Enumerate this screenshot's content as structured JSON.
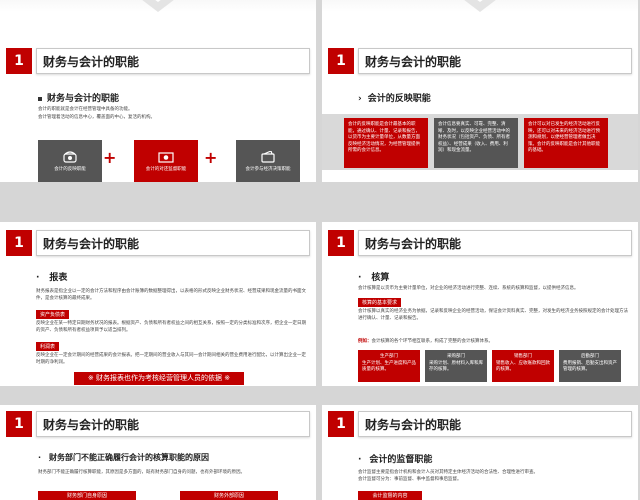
{
  "slide1": {
    "num": "1",
    "title": "财务与会计的职能",
    "subtitle": "财务与会计的职能",
    "body": [
      "会计的职能就是会计在经营管理中具备的功能。",
      "会计管理着活动的信息中心，覆盖面的中心，复活的机构。"
    ],
    "icons": [
      {
        "label": "会计的反映职能",
        "icon": "phone-icon"
      },
      {
        "label": "会计的对还监督职能",
        "icon": "money-icon"
      },
      {
        "label": "会计参与经济决策职能",
        "icon": "wallet-icon"
      }
    ],
    "plus": "+"
  },
  "slide2": {
    "num": "1",
    "title": "财务与会计的职能",
    "subtitle": "会计的反映职能",
    "boxes": [
      "会计的反映职能是会计最基本的职能，通过确认、计量、记录和报告，以货币为主要计量单位，从数量方面反映经济活动情况，为经营管理提供所需的会计信息。",
      "会计信息要真实、可靠、完整、清晰、及时，以反映企业经营活动中的财务状况（包括资产、负债、所有者权益）、经营成果（收入、费用、利润）和现金流量。",
      "会计可以对已发生的经济活动进行反映，还可以对未来的经济活动进行预测和规划，以便经营管理者做出决策。会计的反映职能是会计其他职能的基础。"
    ]
  },
  "slide3": {
    "num": "1",
    "title": "财务与会计的职能",
    "subtitle": "报表",
    "intro": "财务报表是指企业以一定的会计方法和程序由会计账簿的数据整理得出，以表格的形式反映企业财务状况、经营成果和现金流量的书面文件，是会计核算的最终成果。",
    "tag1": "资产负债表",
    "tag1_text": "反映企业在某一特定日期财务状况的报表。根据资产、负债和所有者权益之间的相互关系，按照一定的分类标准和次序，把企业一定日期的资产、负债和所有者权益项目予以适当排列。",
    "tag2": "利润表",
    "tag2_text": "反映企业在一定会计期间的经营成果的会计报表。把一定期间的营业收入与其同一会计期间相关的营业费用进行配比，以计算出企业一定时期的净利润。",
    "banner": "※ 财务报表也作为考核经营管理人员的依据 ※"
  },
  "slide4": {
    "num": "1",
    "title": "财务与会计的职能",
    "subtitle": "核算",
    "intro": "会计核算是以货币为主要计量单位，对企业的经济活动进行完整、连续、系统的核算和监督，以提供经济信息。",
    "tag": "核算的基本要求",
    "tag_text": "会计核算以真实的经济业务为依据，记录和反映企业的经营活动，保证会计资料真实、完整，对发生的经济业务按照规定的会计处理方法进行确认、计量、记录和报告。",
    "note_label": "例如：",
    "note": "会计核算的各个环节相互联系，构成了完整的会计核算体系。",
    "boxes": [
      {
        "head": "生产部门",
        "text": "生产计划、生产进度和产品质量的核算。"
      },
      {
        "head": "采购部门",
        "text": "采购计划、原材料入库和库存的核算。"
      },
      {
        "head": "销售部门",
        "text": "销售收入、应收账款和回款的核算。"
      },
      {
        "head": "后勤部门",
        "text": "费用报销、后勤支出和资产管理的核算。"
      }
    ]
  },
  "slide5": {
    "num": "1",
    "title": "财务与会计的职能",
    "subtitle": "财务部门不能正确履行会计的核算职能的原因",
    "intro": "财务部门不能正确履行核算职能，其原因是多方面的，既有财务部门自身的问题，也有外部环境的原因。",
    "btn1": "财务部门自身原因",
    "btn2": "财务外部原因"
  },
  "slide6": {
    "num": "1",
    "title": "财务与会计的职能",
    "subtitle": "会计的监督职能",
    "intro": "会计监督主要是指会计机构和会计人员对其特定主体经济活动的合法性、合理性进行审查。",
    "intro2": "会计监督可分为：事前监督、事中监督和事后监督。",
    "btn": "会计监督的内容"
  }
}
